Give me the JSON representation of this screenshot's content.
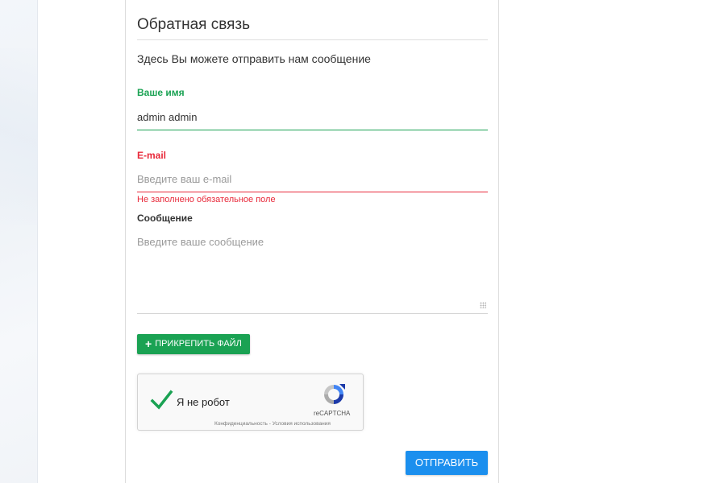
{
  "form": {
    "title": "Обратная связь",
    "subtitle": "Здесь Вы можете отправить нам сообщение",
    "name": {
      "label": "Ваше имя",
      "value": "admin admin"
    },
    "email": {
      "label": "E-mail",
      "placeholder": "Введите ваш e-mail",
      "error": "Не заполнено обязательное поле"
    },
    "message": {
      "label": "Сообщение",
      "placeholder": "Введите ваше сообщение"
    },
    "attach_label": "ПРИКРЕПИТЬ ФАЙЛ",
    "submit_label": "ОТПРАВИТЬ"
  },
  "captcha": {
    "checkbox_label": "Я не робот",
    "brand": "reCAPTCHA",
    "terms": "Конфиденциальность - Условия использования"
  },
  "colors": {
    "success": "#1aa253",
    "error": "#e8293a",
    "primary": "#1b8fee"
  },
  "icons": {
    "attach": "plus-icon",
    "captcha_check": "checkmark-icon",
    "captcha_logo": "recaptcha-logo-icon"
  }
}
